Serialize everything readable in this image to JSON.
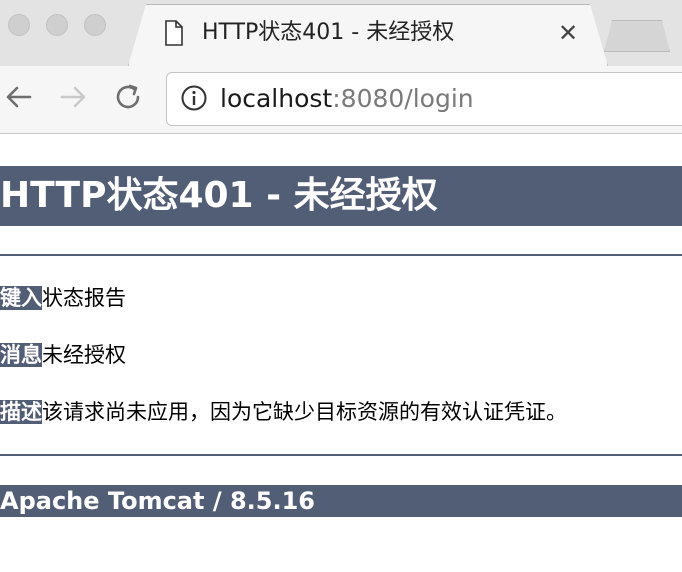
{
  "browser": {
    "tab_title": "HTTP状态401 - 未经授权",
    "url_host": "localhost",
    "url_rest": ":8080/login"
  },
  "page": {
    "heading": "HTTP状态401 - 未经授权",
    "rows": [
      {
        "label": "键入",
        "value": "状态报告"
      },
      {
        "label": "消息",
        "value": "未经授权"
      },
      {
        "label": "描述",
        "value": "该请求尚未应用，因为它缺少目标资源的有效认证凭证。"
      }
    ],
    "footer": "Apache Tomcat / 8.5.16"
  }
}
